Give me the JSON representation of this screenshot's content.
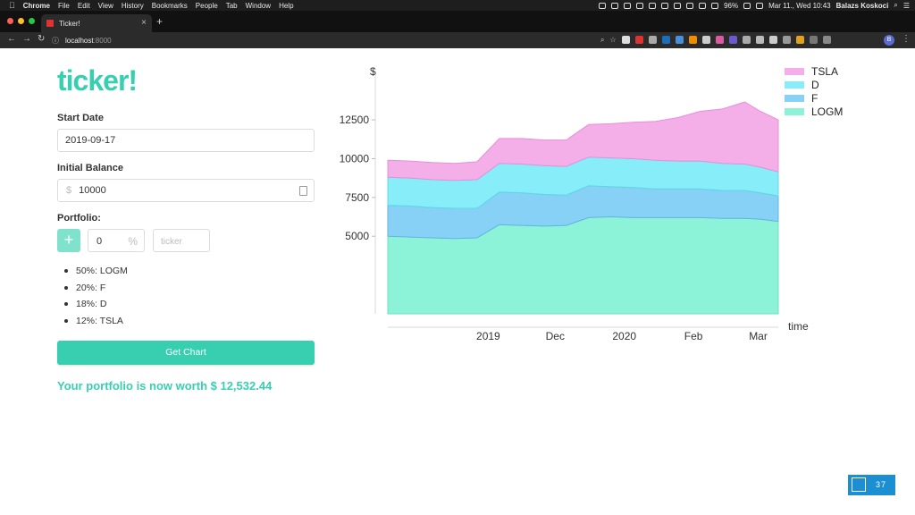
{
  "menubar": {
    "app_name": "Chrome",
    "items": [
      "File",
      "Edit",
      "View",
      "History",
      "Bookmarks",
      "People",
      "Tab",
      "Window",
      "Help"
    ],
    "battery": "96%",
    "datetime": "Mar 11., Wed 10:43",
    "user": "Balazs Koskoci"
  },
  "browser": {
    "tab_title": "Ticker!",
    "url_host": "localhost",
    "url_port": ":8000",
    "profile_initial": "B"
  },
  "app": {
    "logo": "ticker!",
    "start_date_label": "Start Date",
    "start_date_value": "2019-09-17",
    "initial_balance_label": "Initial Balance",
    "currency_symbol": "$",
    "initial_balance_value": "10000",
    "portfolio_label": "Portfolio:",
    "add_button": "+",
    "percent_value": "0",
    "percent_symbol": "%",
    "ticker_placeholder": "ticker",
    "holdings": [
      "50%: LOGM",
      "20%: F",
      "18%: D",
      "12%: TSLA"
    ],
    "get_chart_label": "Get Chart",
    "worth_text": "Your portfolio is now worth $ 12,532.44"
  },
  "slide_counter": "37",
  "chart_data": {
    "type": "area",
    "stacked": true,
    "ylabel": "$",
    "xlabel": "time",
    "y_ticks": [
      5000,
      7500,
      10000,
      12500
    ],
    "ylim": [
      0,
      15500
    ],
    "x_range": [
      "2019-09-17",
      "2020-03-10"
    ],
    "x_ticks": [
      {
        "label": "2019",
        "date": "2019-11-01"
      },
      {
        "label": "Dec",
        "date": "2019-12-01"
      },
      {
        "label": "2020",
        "date": "2020-01-01"
      },
      {
        "label": "Feb",
        "date": "2020-02-01"
      },
      {
        "label": "Mar",
        "date": "2020-03-01"
      }
    ],
    "legend_position": "top-right",
    "x": [
      "2019-09-17",
      "2019-09-27",
      "2019-10-07",
      "2019-10-17",
      "2019-10-27",
      "2019-11-06",
      "2019-11-16",
      "2019-11-26",
      "2019-12-06",
      "2019-12-16",
      "2019-12-26",
      "2020-01-05",
      "2020-01-15",
      "2020-01-25",
      "2020-02-04",
      "2020-02-14",
      "2020-02-24",
      "2020-03-02",
      "2020-03-10"
    ],
    "series": [
      {
        "name": "LOGM",
        "color": "#8cf3d8",
        "line": "#6fdfc2",
        "values": [
          5000,
          4950,
          4900,
          4850,
          4900,
          5750,
          5700,
          5650,
          5700,
          6200,
          6250,
          6200,
          6200,
          6200,
          6200,
          6150,
          6150,
          6100,
          5950
        ]
      },
      {
        "name": "F",
        "color": "#87d0f6",
        "line": "#63b3e4",
        "values": [
          2000,
          2000,
          1950,
          1950,
          1900,
          2100,
          2100,
          2050,
          1950,
          2050,
          1950,
          1950,
          1850,
          1850,
          1850,
          1800,
          1800,
          1700,
          1650
        ]
      },
      {
        "name": "D",
        "color": "#87eef9",
        "line": "#5fd8e8",
        "values": [
          1800,
          1800,
          1800,
          1800,
          1850,
          1850,
          1850,
          1850,
          1850,
          1850,
          1850,
          1850,
          1850,
          1800,
          1800,
          1750,
          1700,
          1650,
          1550
        ]
      },
      {
        "name": "TSLA",
        "color": "#f4aee8",
        "line": "#e690d8",
        "values": [
          1100,
          1100,
          1100,
          1100,
          1150,
          1600,
          1650,
          1650,
          1700,
          2100,
          2200,
          2350,
          2500,
          2800,
          3200,
          3500,
          4000,
          3600,
          3350
        ]
      }
    ]
  }
}
